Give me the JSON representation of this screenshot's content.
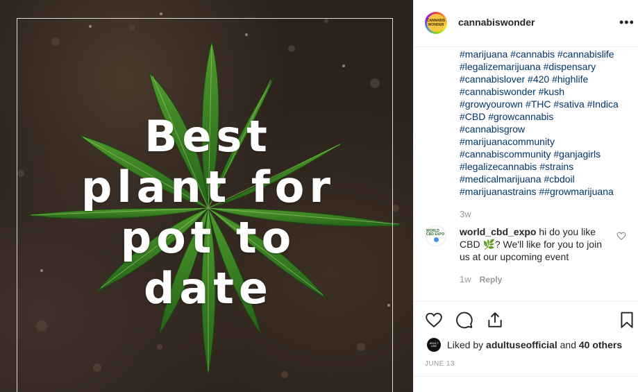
{
  "post": {
    "image": {
      "headline_lines": [
        "Best",
        "plant for",
        "pot to",
        "date"
      ]
    },
    "header": {
      "avatar_text": "CANNABIS WONDER",
      "username": "cannabiswonder",
      "more_icon": "more-horizontal-icon",
      "more_glyph": "•••"
    },
    "caption": {
      "lines": [
        "#marijuana #cannabis #cannabislife",
        "#legalizemarijuana #dispensary",
        "#cannabislover #420 #highlife",
        "#cannabiswonder #kush",
        "#growyourown #THC #sativa #Indica",
        "#CBD #growcannabis",
        "#cannabisgrow",
        "#marijuanacommunity",
        "#cannabiscommunity #ganjagirls",
        "#legalizecannabis #strains",
        "#medicalmarijuana #cbdoil",
        "#marijuanastrains ##growmarijuana"
      ],
      "time": "3w"
    },
    "comment": {
      "avatar_text": "WORLD CBD EXPO",
      "author": "world_cbd_expo",
      "text_line1": " hi do you like",
      "text_line2": "CBD 🌿? We'll like for you to join",
      "text_line3": "us at our upcoming event",
      "time": "1w",
      "reply_label": "Reply"
    },
    "actions": {
      "like_icon": "heart-icon",
      "comment_icon": "comment-icon",
      "share_icon": "share-icon",
      "save_icon": "bookmark-icon"
    },
    "likes": {
      "avatar_text": "ADULT USE",
      "prefix": "Liked by ",
      "user": "adultuseofficial",
      "and": " and ",
      "others": "40 others"
    },
    "date": "JUNE 13"
  },
  "colors": {
    "hashtag": "#003569",
    "muted": "#999999",
    "text": "#262626",
    "leaf_dark": "#1f5a16",
    "leaf_light": "#4f9a2c"
  }
}
